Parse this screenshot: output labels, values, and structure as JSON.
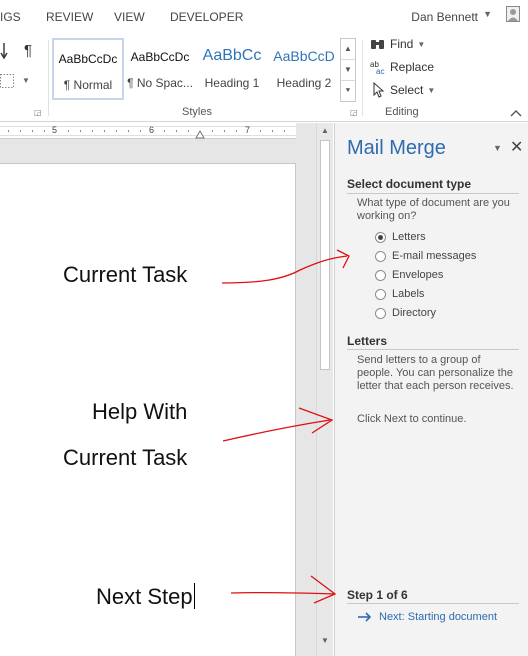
{
  "tabs": [
    "IGS",
    "REVIEW",
    "VIEW",
    "DEVELOPER"
  ],
  "user": {
    "name": "Dan Bennett"
  },
  "ribbon": {
    "styles": [
      {
        "sample": "AaBbCcDc",
        "name": "¶ Normal",
        "selected": true
      },
      {
        "sample": "AaBbCcDc",
        "name": "¶ No Spac..."
      },
      {
        "sample": "AaBbCc",
        "name": "Heading 1"
      },
      {
        "sample": "AaBbCcD",
        "name": "Heading 2"
      }
    ],
    "styles_group_label": "Styles",
    "editing": {
      "find": "Find",
      "replace": "Replace",
      "select": "Select",
      "group_label": "Editing"
    },
    "paragraph_mark": "¶"
  },
  "ruler": {
    "numbers": [
      "5",
      "6",
      "7"
    ]
  },
  "document": {
    "lines": [
      "Current Task",
      "Help With",
      "Current Task",
      "Next Step"
    ]
  },
  "mail_merge": {
    "title": "Mail Merge",
    "select_heading": "Select document type",
    "question": "What type of document are you working on?",
    "options": [
      {
        "label": "Letters",
        "selected": true
      },
      {
        "label": "E-mail messages"
      },
      {
        "label": "Envelopes"
      },
      {
        "label": "Labels"
      },
      {
        "label": "Directory"
      }
    ],
    "letters_heading": "Letters",
    "letters_desc": "Send letters to a group of people. You can personalize the letter that each person receives.",
    "click_next": "Click Next to continue.",
    "step": "Step 1 of 6",
    "next_link": "Next: Starting document"
  },
  "colors": {
    "accent": "#2e6bb0",
    "annotation": "#e01010",
    "heading1": "#2e75b6"
  }
}
